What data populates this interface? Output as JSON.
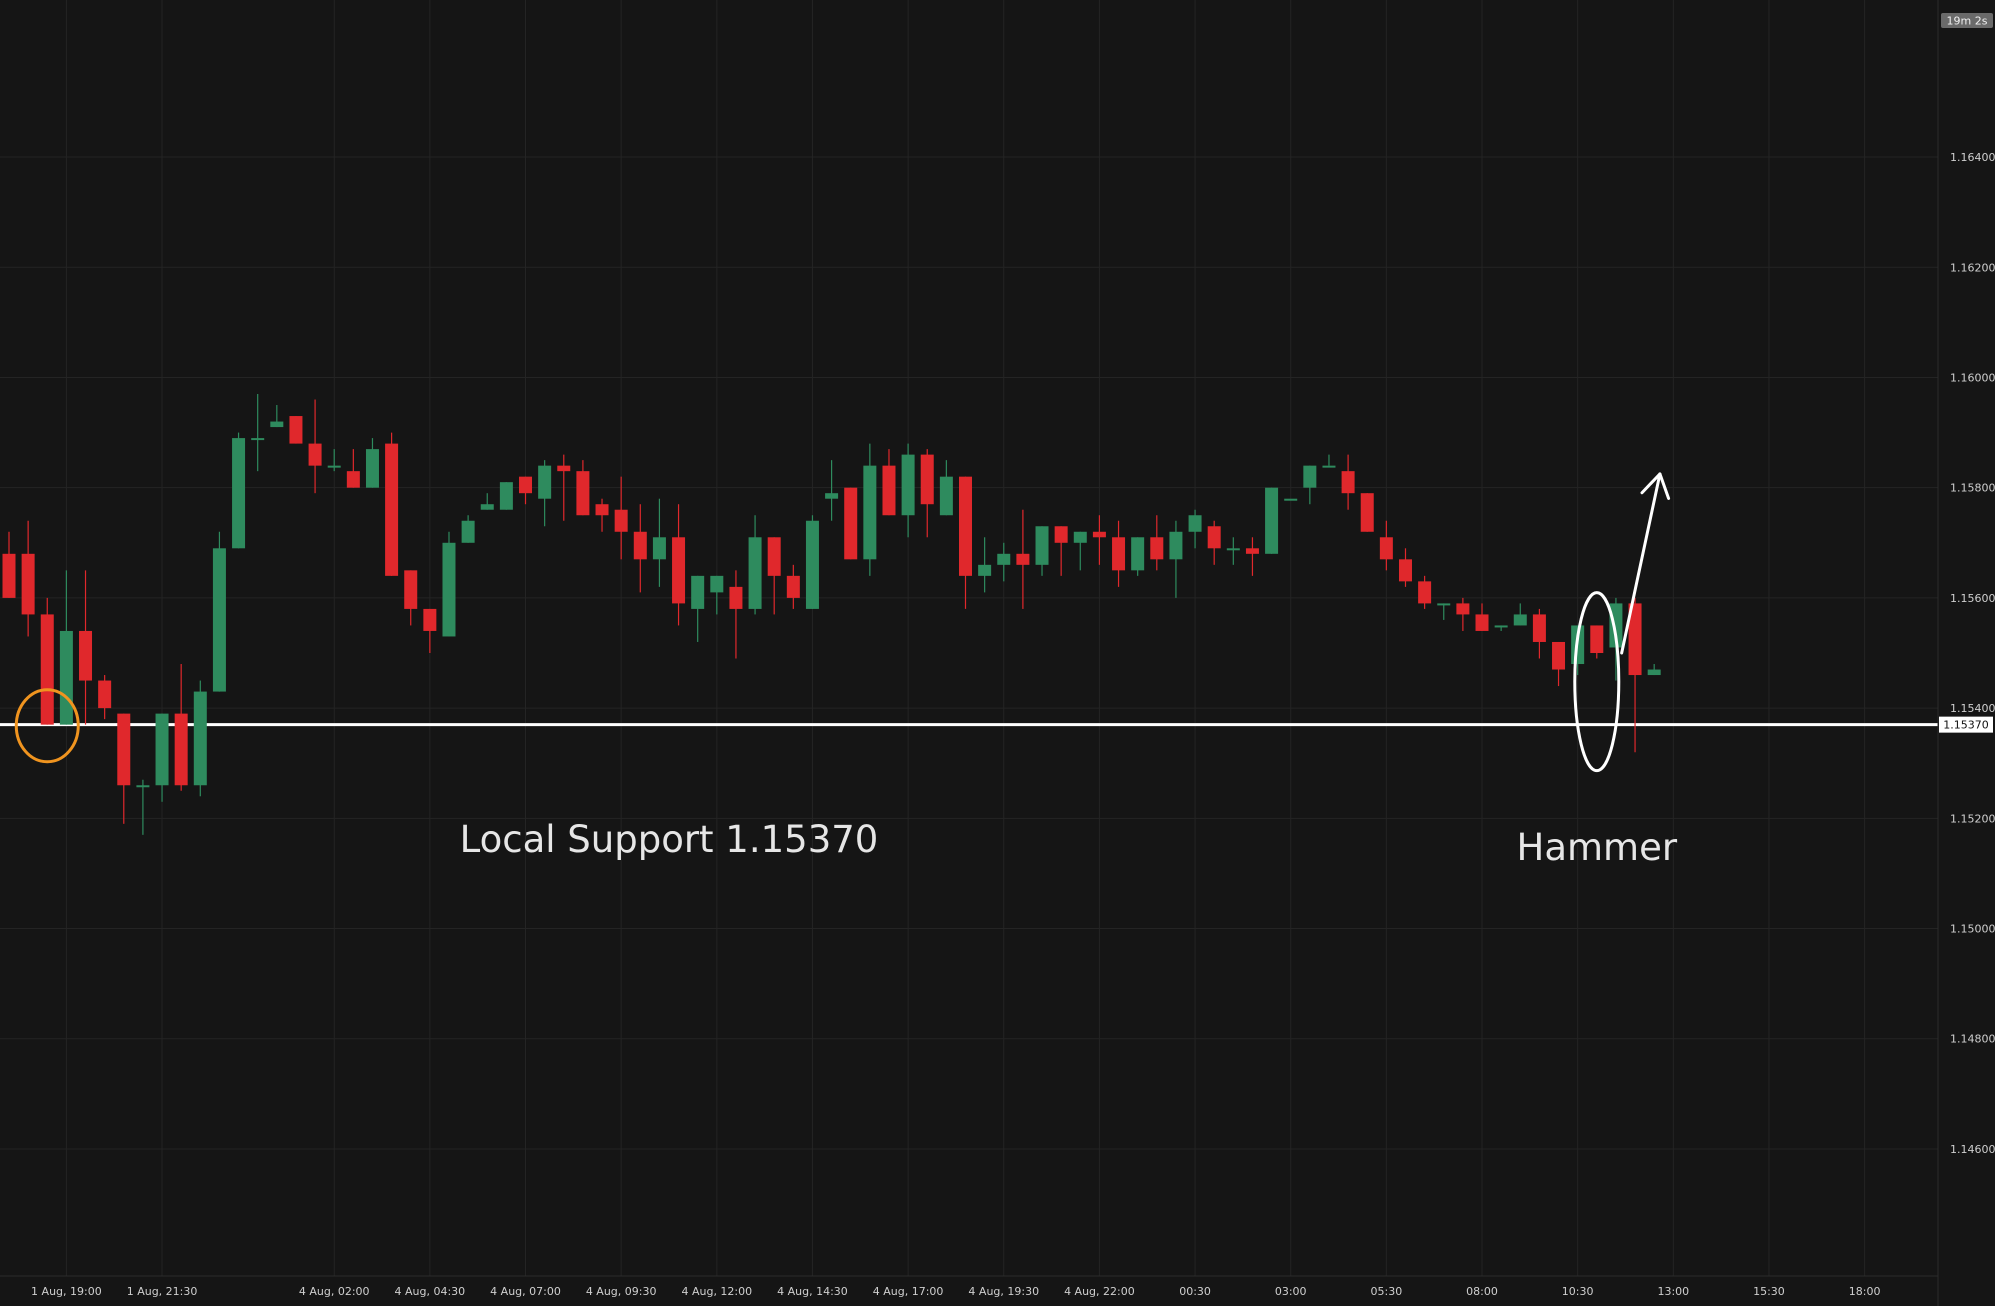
{
  "chart_data": {
    "type": "candlestick",
    "theme": {
      "background": "#151515",
      "grid": "#242424",
      "up": "#2e8b5e",
      "down": "#e0282c",
      "support_line": "#ffffff",
      "highlight_circle": "#f0941f"
    },
    "yaxis": {
      "ylim": [
        1.14315,
        1.16685
      ],
      "ticks": [
        "1.16400",
        "1.16200",
        "1.16000",
        "1.15800",
        "1.15600",
        "1.15400",
        "1.15200",
        "1.15000",
        "1.14800",
        "1.14600"
      ],
      "price_badge": "1.15370",
      "timer_badge": "19m 2s"
    },
    "xaxis": {
      "start_time": "1 Aug, 17:30",
      "interval_minutes": 30,
      "ticks": [
        {
          "label": "1 Aug, 19:00",
          "index": 3
        },
        {
          "label": "1 Aug, 21:30",
          "index": 8
        },
        {
          "label": "4 Aug, 02:00",
          "index": 17
        },
        {
          "label": "4 Aug, 04:30",
          "index": 22
        },
        {
          "label": "4 Aug, 07:00",
          "index": 27
        },
        {
          "label": "4 Aug, 09:30",
          "index": 32
        },
        {
          "label": "4 Aug, 12:00",
          "index": 37
        },
        {
          "label": "4 Aug, 14:30",
          "index": 42
        },
        {
          "label": "4 Aug, 17:00",
          "index": 47
        },
        {
          "label": "4 Aug, 19:30",
          "index": 52
        },
        {
          "label": "4 Aug, 22:00",
          "index": 57
        },
        {
          "label": "00:30",
          "index": 62
        },
        {
          "label": "03:00",
          "index": 67
        },
        {
          "label": "05:30",
          "index": 72
        },
        {
          "label": "08:00",
          "index": 77
        },
        {
          "label": "10:30",
          "index": 82
        },
        {
          "label": "13:00",
          "index": 87
        },
        {
          "label": "15:30",
          "index": 92
        },
        {
          "label": "18:00",
          "index": 97
        }
      ]
    },
    "candles": [
      [
        1.1568,
        1.1572,
        1.156,
        1.156
      ],
      [
        1.1568,
        1.1574,
        1.1553,
        1.1557
      ],
      [
        1.1557,
        1.156,
        1.1537,
        1.1537
      ],
      [
        1.1537,
        1.1565,
        1.1537,
        1.1554
      ],
      [
        1.1554,
        1.1565,
        1.1537,
        1.1545
      ],
      [
        1.1545,
        1.1546,
        1.1538,
        1.154
      ],
      [
        1.1539,
        1.1539,
        1.1519,
        1.1526
      ],
      [
        1.1526,
        1.1527,
        1.1517,
        1.1526
      ],
      [
        1.1526,
        1.1539,
        1.1523,
        1.1539
      ],
      [
        1.1539,
        1.1548,
        1.1525,
        1.1526
      ],
      [
        1.1526,
        1.1545,
        1.1524,
        1.1543
      ],
      [
        1.1543,
        1.1572,
        1.1543,
        1.1569
      ],
      [
        1.1569,
        1.159,
        1.1569,
        1.1589
      ],
      [
        1.1589,
        1.1597,
        1.1583,
        1.1589
      ],
      [
        1.1591,
        1.1595,
        1.1591,
        1.1592
      ],
      [
        1.1593,
        1.1593,
        1.1588,
        1.1588
      ],
      [
        1.1588,
        1.1596,
        1.1579,
        1.1584
      ],
      [
        1.1584,
        1.1587,
        1.1583,
        1.1584
      ],
      [
        1.1583,
        1.1587,
        1.158,
        1.158
      ],
      [
        1.158,
        1.1589,
        1.158,
        1.1587
      ],
      [
        1.1588,
        1.159,
        1.1564,
        1.1564
      ],
      [
        1.1565,
        1.1565,
        1.1555,
        1.1558
      ],
      [
        1.1558,
        1.1558,
        1.155,
        1.1554
      ],
      [
        1.1553,
        1.1572,
        1.1553,
        1.157
      ],
      [
        1.157,
        1.1575,
        1.157,
        1.1574
      ],
      [
        1.1576,
        1.1579,
        1.1576,
        1.1577
      ],
      [
        1.1576,
        1.158,
        1.1576,
        1.1581
      ],
      [
        1.1582,
        1.1581,
        1.1577,
        1.1579
      ],
      [
        1.1578,
        1.1585,
        1.1573,
        1.1584
      ],
      [
        1.1584,
        1.1586,
        1.1574,
        1.1583
      ],
      [
        1.1583,
        1.1585,
        1.1575,
        1.1575
      ],
      [
        1.1577,
        1.1578,
        1.1572,
        1.1575
      ],
      [
        1.1576,
        1.1582,
        1.1567,
        1.1572
      ],
      [
        1.1572,
        1.1577,
        1.1561,
        1.1567
      ],
      [
        1.1567,
        1.1578,
        1.1562,
        1.1571
      ],
      [
        1.1571,
        1.1577,
        1.1555,
        1.1559
      ],
      [
        1.1558,
        1.1564,
        1.1552,
        1.1564
      ],
      [
        1.1561,
        1.1564,
        1.1557,
        1.1564
      ],
      [
        1.1562,
        1.1565,
        1.1549,
        1.1558
      ],
      [
        1.1558,
        1.1575,
        1.1557,
        1.1571
      ],
      [
        1.1571,
        1.1571,
        1.1557,
        1.1564
      ],
      [
        1.1564,
        1.1566,
        1.1558,
        1.156
      ],
      [
        1.1558,
        1.1575,
        1.1558,
        1.1574
      ],
      [
        1.1578,
        1.1585,
        1.1574,
        1.1579
      ],
      [
        1.158,
        1.158,
        1.1567,
        1.1567
      ],
      [
        1.1567,
        1.1588,
        1.1564,
        1.1584
      ],
      [
        1.1584,
        1.1587,
        1.1575,
        1.1575
      ],
      [
        1.1575,
        1.1588,
        1.1571,
        1.1586
      ],
      [
        1.1586,
        1.1587,
        1.1571,
        1.1577
      ],
      [
        1.1575,
        1.1585,
        1.1575,
        1.1582
      ],
      [
        1.1582,
        1.1582,
        1.1558,
        1.1564
      ],
      [
        1.1564,
        1.1571,
        1.1561,
        1.1566
      ],
      [
        1.1566,
        1.157,
        1.1563,
        1.1568
      ],
      [
        1.1568,
        1.1576,
        1.1558,
        1.1566
      ],
      [
        1.1566,
        1.1572,
        1.1564,
        1.1573
      ],
      [
        1.1573,
        1.1573,
        1.1564,
        1.157
      ],
      [
        1.157,
        1.157,
        1.1565,
        1.1572
      ],
      [
        1.1572,
        1.1575,
        1.1566,
        1.1571
      ],
      [
        1.1571,
        1.1574,
        1.1562,
        1.1565
      ],
      [
        1.1565,
        1.1566,
        1.1564,
        1.1571
      ],
      [
        1.1571,
        1.1575,
        1.1565,
        1.1567
      ],
      [
        1.1567,
        1.1574,
        1.156,
        1.1572
      ],
      [
        1.1572,
        1.1576,
        1.1569,
        1.1575
      ],
      [
        1.1573,
        1.1574,
        1.1566,
        1.1569
      ],
      [
        1.1569,
        1.1571,
        1.1566,
        1.1569
      ],
      [
        1.1569,
        1.1571,
        1.1564,
        1.1568
      ],
      [
        1.1568,
        1.158,
        1.1568,
        1.158
      ],
      [
        1.1578,
        1.1578,
        1.1578,
        1.1578
      ],
      [
        1.158,
        1.1584,
        1.1577,
        1.1584
      ],
      [
        1.1584,
        1.1586,
        1.1585,
        1.1584
      ],
      [
        1.1583,
        1.1586,
        1.1576,
        1.1579
      ],
      [
        1.1579,
        1.1579,
        1.1572,
        1.1572
      ],
      [
        1.1571,
        1.1574,
        1.1565,
        1.1567
      ],
      [
        1.1567,
        1.1569,
        1.1562,
        1.1563
      ],
      [
        1.1563,
        1.1564,
        1.1558,
        1.1559
      ],
      [
        1.1559,
        1.1559,
        1.1556,
        1.1559
      ],
      [
        1.1559,
        1.156,
        1.1554,
        1.1557
      ],
      [
        1.1557,
        1.1559,
        1.1554,
        1.1554
      ],
      [
        1.1555,
        1.1555,
        1.1554,
        1.1555
      ],
      [
        1.1555,
        1.1559,
        1.1555,
        1.1557
      ],
      [
        1.1557,
        1.1558,
        1.1549,
        1.1552
      ],
      [
        1.1552,
        1.1552,
        1.1544,
        1.1547
      ],
      [
        1.1548,
        1.1555,
        1.1546,
        1.1555
      ],
      [
        1.1555,
        1.1554,
        1.1549,
        1.155
      ],
      [
        1.1551,
        1.156,
        1.1545,
        1.1559
      ],
      [
        1.1559,
        1.156,
        1.1532,
        1.1546
      ],
      [
        1.1546,
        1.1548,
        1.1546,
        1.1547
      ]
    ],
    "support": {
      "value": 1.1537,
      "label": "Local Support 1.15370"
    },
    "annotations": [
      {
        "type": "ellipse",
        "color": "orange",
        "index": 2,
        "price": 1.15368
      },
      {
        "type": "ellipse",
        "color": "white",
        "index": 83,
        "price": 1.15448,
        "label": "Hammer"
      },
      {
        "type": "arrow",
        "from": {
          "index": 84.3,
          "price": 1.155
        },
        "to": {
          "index": 86.3,
          "price": 1.15825
        }
      }
    ]
  }
}
